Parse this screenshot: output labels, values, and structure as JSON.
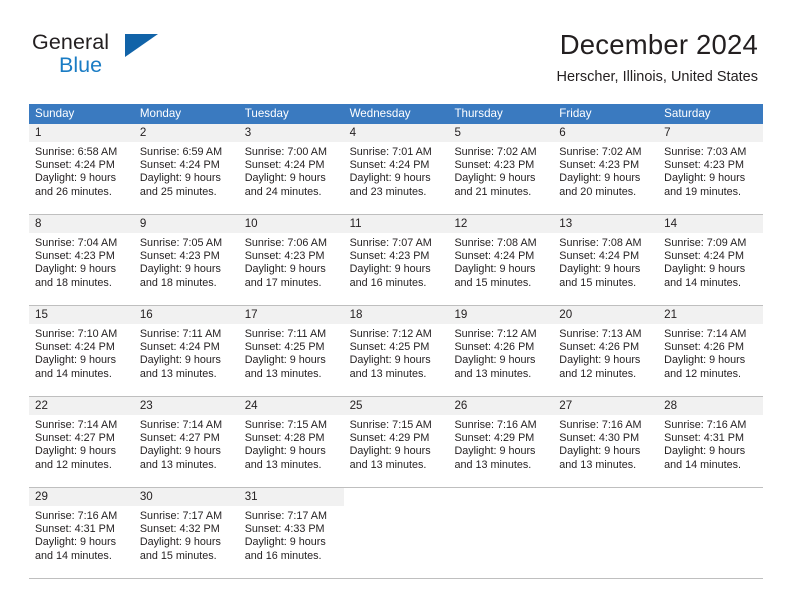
{
  "brand": {
    "name_top": "General",
    "name_bottom": "Blue",
    "logo_icon": "triangle-flag-icon",
    "accent_color": "#1163a8",
    "blue_text_color": "#1a7cc4"
  },
  "header": {
    "month_title": "December 2024",
    "location": "Herscher, Illinois, United States"
  },
  "calendar": {
    "header_background": "#3a7ac0",
    "day_band_background": "#f1f1f1",
    "grid_line_color": "#bfbfbf",
    "weekdays": [
      "Sunday",
      "Monday",
      "Tuesday",
      "Wednesday",
      "Thursday",
      "Friday",
      "Saturday"
    ],
    "weeks": [
      [
        {
          "day": "1",
          "sunrise": "Sunrise: 6:58 AM",
          "sunset": "Sunset: 4:24 PM",
          "daylight_line1": "Daylight: 9 hours",
          "daylight_line2": "and 26 minutes."
        },
        {
          "day": "2",
          "sunrise": "Sunrise: 6:59 AM",
          "sunset": "Sunset: 4:24 PM",
          "daylight_line1": "Daylight: 9 hours",
          "daylight_line2": "and 25 minutes."
        },
        {
          "day": "3",
          "sunrise": "Sunrise: 7:00 AM",
          "sunset": "Sunset: 4:24 PM",
          "daylight_line1": "Daylight: 9 hours",
          "daylight_line2": "and 24 minutes."
        },
        {
          "day": "4",
          "sunrise": "Sunrise: 7:01 AM",
          "sunset": "Sunset: 4:24 PM",
          "daylight_line1": "Daylight: 9 hours",
          "daylight_line2": "and 23 minutes."
        },
        {
          "day": "5",
          "sunrise": "Sunrise: 7:02 AM",
          "sunset": "Sunset: 4:23 PM",
          "daylight_line1": "Daylight: 9 hours",
          "daylight_line2": "and 21 minutes."
        },
        {
          "day": "6",
          "sunrise": "Sunrise: 7:02 AM",
          "sunset": "Sunset: 4:23 PM",
          "daylight_line1": "Daylight: 9 hours",
          "daylight_line2": "and 20 minutes."
        },
        {
          "day": "7",
          "sunrise": "Sunrise: 7:03 AM",
          "sunset": "Sunset: 4:23 PM",
          "daylight_line1": "Daylight: 9 hours",
          "daylight_line2": "and 19 minutes."
        }
      ],
      [
        {
          "day": "8",
          "sunrise": "Sunrise: 7:04 AM",
          "sunset": "Sunset: 4:23 PM",
          "daylight_line1": "Daylight: 9 hours",
          "daylight_line2": "and 18 minutes."
        },
        {
          "day": "9",
          "sunrise": "Sunrise: 7:05 AM",
          "sunset": "Sunset: 4:23 PM",
          "daylight_line1": "Daylight: 9 hours",
          "daylight_line2": "and 18 minutes."
        },
        {
          "day": "10",
          "sunrise": "Sunrise: 7:06 AM",
          "sunset": "Sunset: 4:23 PM",
          "daylight_line1": "Daylight: 9 hours",
          "daylight_line2": "and 17 minutes."
        },
        {
          "day": "11",
          "sunrise": "Sunrise: 7:07 AM",
          "sunset": "Sunset: 4:23 PM",
          "daylight_line1": "Daylight: 9 hours",
          "daylight_line2": "and 16 minutes."
        },
        {
          "day": "12",
          "sunrise": "Sunrise: 7:08 AM",
          "sunset": "Sunset: 4:24 PM",
          "daylight_line1": "Daylight: 9 hours",
          "daylight_line2": "and 15 minutes."
        },
        {
          "day": "13",
          "sunrise": "Sunrise: 7:08 AM",
          "sunset": "Sunset: 4:24 PM",
          "daylight_line1": "Daylight: 9 hours",
          "daylight_line2": "and 15 minutes."
        },
        {
          "day": "14",
          "sunrise": "Sunrise: 7:09 AM",
          "sunset": "Sunset: 4:24 PM",
          "daylight_line1": "Daylight: 9 hours",
          "daylight_line2": "and 14 minutes."
        }
      ],
      [
        {
          "day": "15",
          "sunrise": "Sunrise: 7:10 AM",
          "sunset": "Sunset: 4:24 PM",
          "daylight_line1": "Daylight: 9 hours",
          "daylight_line2": "and 14 minutes."
        },
        {
          "day": "16",
          "sunrise": "Sunrise: 7:11 AM",
          "sunset": "Sunset: 4:24 PM",
          "daylight_line1": "Daylight: 9 hours",
          "daylight_line2": "and 13 minutes."
        },
        {
          "day": "17",
          "sunrise": "Sunrise: 7:11 AM",
          "sunset": "Sunset: 4:25 PM",
          "daylight_line1": "Daylight: 9 hours",
          "daylight_line2": "and 13 minutes."
        },
        {
          "day": "18",
          "sunrise": "Sunrise: 7:12 AM",
          "sunset": "Sunset: 4:25 PM",
          "daylight_line1": "Daylight: 9 hours",
          "daylight_line2": "and 13 minutes."
        },
        {
          "day": "19",
          "sunrise": "Sunrise: 7:12 AM",
          "sunset": "Sunset: 4:26 PM",
          "daylight_line1": "Daylight: 9 hours",
          "daylight_line2": "and 13 minutes."
        },
        {
          "day": "20",
          "sunrise": "Sunrise: 7:13 AM",
          "sunset": "Sunset: 4:26 PM",
          "daylight_line1": "Daylight: 9 hours",
          "daylight_line2": "and 12 minutes."
        },
        {
          "day": "21",
          "sunrise": "Sunrise: 7:14 AM",
          "sunset": "Sunset: 4:26 PM",
          "daylight_line1": "Daylight: 9 hours",
          "daylight_line2": "and 12 minutes."
        }
      ],
      [
        {
          "day": "22",
          "sunrise": "Sunrise: 7:14 AM",
          "sunset": "Sunset: 4:27 PM",
          "daylight_line1": "Daylight: 9 hours",
          "daylight_line2": "and 12 minutes."
        },
        {
          "day": "23",
          "sunrise": "Sunrise: 7:14 AM",
          "sunset": "Sunset: 4:27 PM",
          "daylight_line1": "Daylight: 9 hours",
          "daylight_line2": "and 13 minutes."
        },
        {
          "day": "24",
          "sunrise": "Sunrise: 7:15 AM",
          "sunset": "Sunset: 4:28 PM",
          "daylight_line1": "Daylight: 9 hours",
          "daylight_line2": "and 13 minutes."
        },
        {
          "day": "25",
          "sunrise": "Sunrise: 7:15 AM",
          "sunset": "Sunset: 4:29 PM",
          "daylight_line1": "Daylight: 9 hours",
          "daylight_line2": "and 13 minutes."
        },
        {
          "day": "26",
          "sunrise": "Sunrise: 7:16 AM",
          "sunset": "Sunset: 4:29 PM",
          "daylight_line1": "Daylight: 9 hours",
          "daylight_line2": "and 13 minutes."
        },
        {
          "day": "27",
          "sunrise": "Sunrise: 7:16 AM",
          "sunset": "Sunset: 4:30 PM",
          "daylight_line1": "Daylight: 9 hours",
          "daylight_line2": "and 13 minutes."
        },
        {
          "day": "28",
          "sunrise": "Sunrise: 7:16 AM",
          "sunset": "Sunset: 4:31 PM",
          "daylight_line1": "Daylight: 9 hours",
          "daylight_line2": "and 14 minutes."
        }
      ],
      [
        {
          "day": "29",
          "sunrise": "Sunrise: 7:16 AM",
          "sunset": "Sunset: 4:31 PM",
          "daylight_line1": "Daylight: 9 hours",
          "daylight_line2": "and 14 minutes."
        },
        {
          "day": "30",
          "sunrise": "Sunrise: 7:17 AM",
          "sunset": "Sunset: 4:32 PM",
          "daylight_line1": "Daylight: 9 hours",
          "daylight_line2": "and 15 minutes."
        },
        {
          "day": "31",
          "sunrise": "Sunrise: 7:17 AM",
          "sunset": "Sunset: 4:33 PM",
          "daylight_line1": "Daylight: 9 hours",
          "daylight_line2": "and 16 minutes."
        },
        {
          "day": "",
          "sunrise": "",
          "sunset": "",
          "daylight_line1": "",
          "daylight_line2": ""
        },
        {
          "day": "",
          "sunrise": "",
          "sunset": "",
          "daylight_line1": "",
          "daylight_line2": ""
        },
        {
          "day": "",
          "sunrise": "",
          "sunset": "",
          "daylight_line1": "",
          "daylight_line2": ""
        },
        {
          "day": "",
          "sunrise": "",
          "sunset": "",
          "daylight_line1": "",
          "daylight_line2": ""
        }
      ]
    ]
  }
}
